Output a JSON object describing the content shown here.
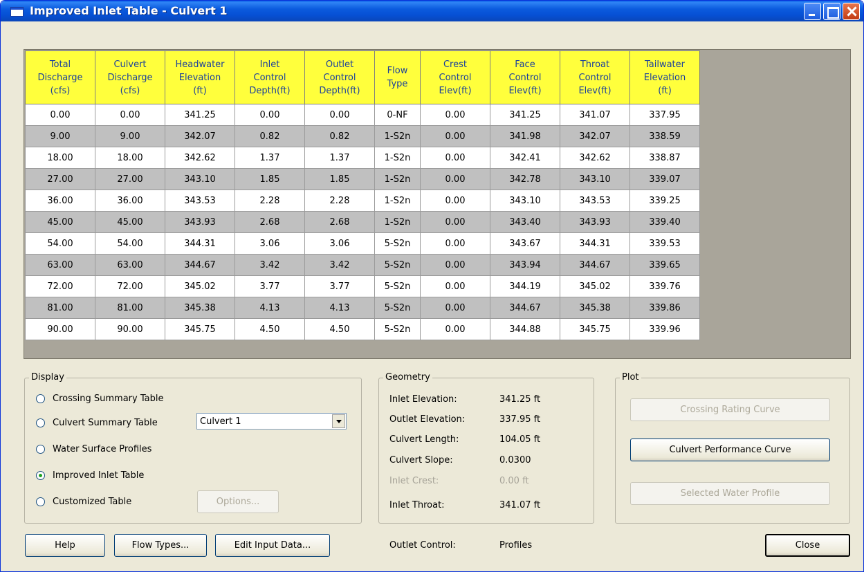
{
  "window": {
    "title": "Improved Inlet Table - Culvert 1"
  },
  "table": {
    "headers": [
      [
        "Total",
        "Discharge",
        "(cfs)"
      ],
      [
        "Culvert",
        "Discharge",
        "(cfs)"
      ],
      [
        "Headwater",
        "Elevation",
        "(ft)"
      ],
      [
        "Inlet",
        "Control",
        "Depth(ft)"
      ],
      [
        "Outlet",
        "Control",
        "Depth(ft)"
      ],
      [
        "Flow",
        "Type"
      ],
      [
        "Crest",
        "Control",
        "Elev(ft)"
      ],
      [
        "Face",
        "Control",
        "Elev(ft)"
      ],
      [
        "Throat",
        "Control",
        "Elev(ft)"
      ],
      [
        "Tailwater",
        "Elevation",
        "(ft)"
      ]
    ],
    "rows": [
      [
        "0.00",
        "0.00",
        "341.25",
        "0.00",
        "0.00",
        "0-NF",
        "0.00",
        "341.25",
        "341.07",
        "337.95"
      ],
      [
        "9.00",
        "9.00",
        "342.07",
        "0.82",
        "0.82",
        "1-S2n",
        "0.00",
        "341.98",
        "342.07",
        "338.59"
      ],
      [
        "18.00",
        "18.00",
        "342.62",
        "1.37",
        "1.37",
        "1-S2n",
        "0.00",
        "342.41",
        "342.62",
        "338.87"
      ],
      [
        "27.00",
        "27.00",
        "343.10",
        "1.85",
        "1.85",
        "1-S2n",
        "0.00",
        "342.78",
        "343.10",
        "339.07"
      ],
      [
        "36.00",
        "36.00",
        "343.53",
        "2.28",
        "2.28",
        "1-S2n",
        "0.00",
        "343.10",
        "343.53",
        "339.25"
      ],
      [
        "45.00",
        "45.00",
        "343.93",
        "2.68",
        "2.68",
        "1-S2n",
        "0.00",
        "343.40",
        "343.93",
        "339.40"
      ],
      [
        "54.00",
        "54.00",
        "344.31",
        "3.06",
        "3.06",
        "5-S2n",
        "0.00",
        "343.67",
        "344.31",
        "339.53"
      ],
      [
        "63.00",
        "63.00",
        "344.67",
        "3.42",
        "3.42",
        "5-S2n",
        "0.00",
        "343.94",
        "344.67",
        "339.65"
      ],
      [
        "72.00",
        "72.00",
        "345.02",
        "3.77",
        "3.77",
        "5-S2n",
        "0.00",
        "344.19",
        "345.02",
        "339.76"
      ],
      [
        "81.00",
        "81.00",
        "345.38",
        "4.13",
        "4.13",
        "5-S2n",
        "0.00",
        "344.67",
        "345.38",
        "339.86"
      ],
      [
        "90.00",
        "90.00",
        "345.75",
        "4.50",
        "4.50",
        "5-S2n",
        "0.00",
        "344.88",
        "345.75",
        "339.96"
      ]
    ]
  },
  "display": {
    "title": "Display",
    "options": {
      "crossing": "Crossing Summary Table",
      "culvert": "Culvert Summary Table",
      "profiles": "Water Surface Profiles",
      "improved": "Improved Inlet Table",
      "customized": "Customized Table"
    },
    "selected": "Improved Inlet Table",
    "culvert_select": "Culvert 1",
    "options_button": "Options..."
  },
  "geometry": {
    "title": "Geometry",
    "inlet_elevation_label": "Inlet Elevation:",
    "inlet_elevation_value": "341.25 ft",
    "outlet_elevation_label": "Outlet Elevation:",
    "outlet_elevation_value": "337.95 ft",
    "culvert_length_label": "Culvert Length:",
    "culvert_length_value": "104.05 ft",
    "culvert_slope_label": "Culvert Slope:",
    "culvert_slope_value": "0.0300",
    "inlet_crest_label": "Inlet Crest:",
    "inlet_crest_value": "0.00 ft",
    "inlet_throat_label": "Inlet Throat:",
    "inlet_throat_value": "341.07 ft"
  },
  "plot": {
    "title": "Plot",
    "crossing_rating": "Crossing Rating Curve",
    "culvert_performance": "Culvert Performance Curve",
    "selected_profile": "Selected Water Profile"
  },
  "bottom": {
    "help": "Help",
    "flow_types": "Flow Types...",
    "edit_input": "Edit Input Data...",
    "outlet_control_label": "Outlet Control:",
    "outlet_control_value": "Profiles",
    "close": "Close"
  }
}
